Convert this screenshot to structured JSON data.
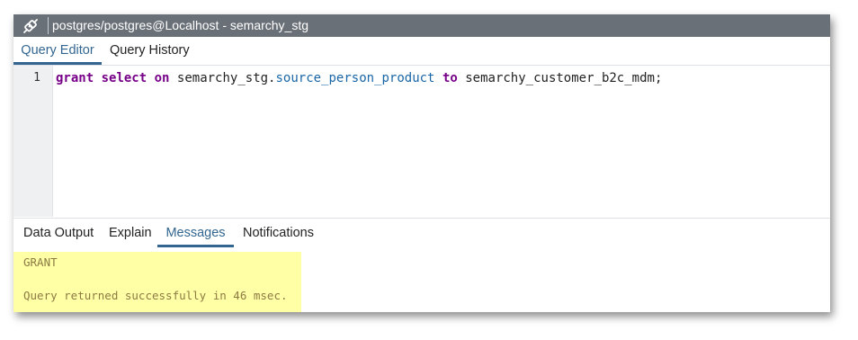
{
  "window": {
    "title": "postgres/postgres@Localhost - semarchy_stg"
  },
  "top_tabs": [
    {
      "label": "Query Editor",
      "active": true
    },
    {
      "label": "Query History",
      "active": false
    }
  ],
  "editor": {
    "line_number": "1",
    "tokens": {
      "grant": "grant",
      "select": "select",
      "on": "on",
      "schema": "semarchy_stg.",
      "table": "source_person_product",
      "to": "to",
      "role": "semarchy_customer_b2c_mdm;"
    }
  },
  "bottom_tabs": [
    {
      "label": "Data Output",
      "active": false
    },
    {
      "label": "Explain",
      "active": false
    },
    {
      "label": "Messages",
      "active": true
    },
    {
      "label": "Notifications",
      "active": false
    }
  ],
  "messages": {
    "line1": "GRANT",
    "line2": "Query returned successfully in 46 msec."
  },
  "colors": {
    "titlebar": "#6a7078",
    "accent": "#326690",
    "keyword": "#770088",
    "variable": "#1a66a6",
    "highlight": "#ffffa6"
  },
  "icons": {
    "connection": "connection-icon"
  }
}
